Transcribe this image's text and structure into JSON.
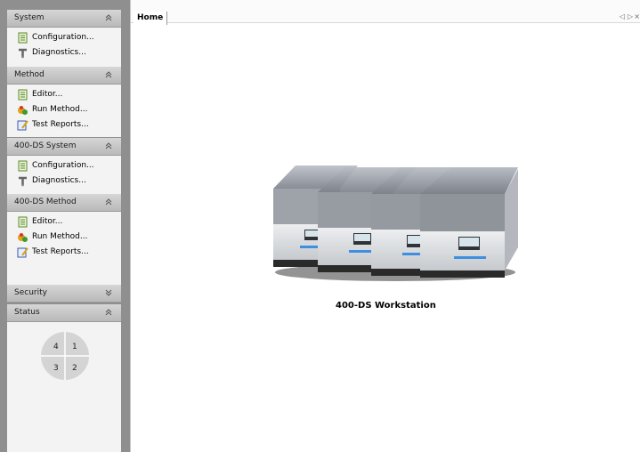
{
  "sidebar": {
    "system": {
      "title": "System",
      "items": [
        {
          "label": "Configuration...",
          "icon": "document-icon"
        },
        {
          "label": "Diagnostics...",
          "icon": "wrench-icon"
        }
      ]
    },
    "method": {
      "title": "Method",
      "items": [
        {
          "label": "Editor...",
          "icon": "document-icon"
        },
        {
          "label": "Run Method...",
          "icon": "run-icon"
        },
        {
          "label": "Test Reports...",
          "icon": "report-icon"
        }
      ]
    },
    "ds_system": {
      "title": "400-DS System",
      "items": [
        {
          "label": "Configuration...",
          "icon": "document-icon"
        },
        {
          "label": "Diagnostics...",
          "icon": "wrench-icon"
        }
      ]
    },
    "ds_method": {
      "title": "400-DS Method",
      "items": [
        {
          "label": "Editor...",
          "icon": "document-icon"
        },
        {
          "label": "Run Method...",
          "icon": "run-icon"
        },
        {
          "label": "Test Reports...",
          "icon": "report-icon"
        }
      ]
    },
    "security": {
      "title": "Security"
    },
    "status": {
      "title": "Status",
      "quadrants": [
        "4",
        "1",
        "3",
        "2"
      ]
    }
  },
  "tabs": {
    "home": "Home"
  },
  "main": {
    "workstation_label": "400-DS Workstation"
  },
  "colors": {
    "sidebar_bg": "#8f8f8f",
    "panel_bg": "#f3f3f3",
    "header_bg": "#c8c8c8"
  }
}
